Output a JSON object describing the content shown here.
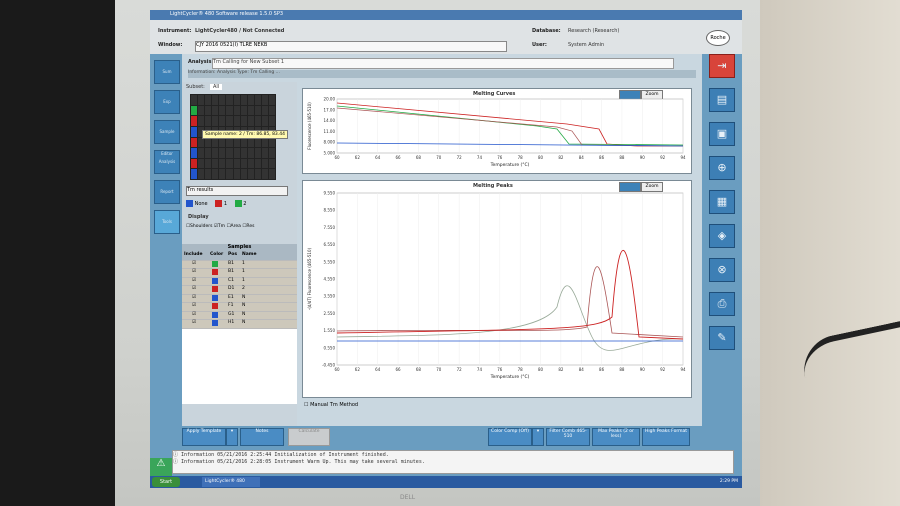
{
  "window": {
    "title": "LightCycler® 480 Software release 1.5.0 SP3"
  },
  "header": {
    "instrument_label": "Instrument:",
    "instrument_value": "LightCycler480 / Not Connected",
    "window_label": "Window:",
    "window_value": "CJY 2016 0521(I) TLRE NEKB",
    "database_label": "Database:",
    "database_value": "Research (Research)",
    "user_label": "User:",
    "user_value": "System Admin",
    "logo": "Roche"
  },
  "nav": {
    "items": [
      "Sum",
      "Exp",
      "Sample Editor",
      "Analysis",
      "Report",
      "Tools"
    ]
  },
  "analysis": {
    "label": "Analysis:",
    "value": "Tm Calling for New Subset 1",
    "info_label": "Information:",
    "info_value": "Analysis Type: Tm Calling ..."
  },
  "left": {
    "subset_label": "Subset:",
    "subset_value": "All",
    "tooltip": "Sample name: 2 / Tm: 86.85, 83.44",
    "results_select": "Tm results",
    "legend": [
      {
        "name": "None",
        "color": "#2255cc"
      },
      {
        "name": "1",
        "color": "#cc2222"
      },
      {
        "name": "2",
        "color": "#22aa44"
      }
    ],
    "display_label": "Display",
    "checks": [
      {
        "label": "Shoulders",
        "checked": false
      },
      {
        "label": "Tm",
        "checked": true
      },
      {
        "label": "Area",
        "checked": false
      },
      {
        "label": "Res",
        "checked": false
      }
    ],
    "samples_title": "Samples",
    "sample_cols": [
      "Include",
      "Color",
      "Pos",
      "Name"
    ],
    "samples": [
      {
        "pos": "B1",
        "name": "1",
        "color": "#22aa44"
      },
      {
        "pos": "B1",
        "name": "1",
        "color": "#cc2222"
      },
      {
        "pos": "C1",
        "name": "1",
        "color": "#2255cc"
      },
      {
        "pos": "D1",
        "name": "2",
        "color": "#cc2222"
      },
      {
        "pos": "E1",
        "name": "N",
        "color": "#2255cc"
      },
      {
        "pos": "F1",
        "name": "N",
        "color": "#cc2222"
      },
      {
        "pos": "G1",
        "name": "N",
        "color": "#2255cc"
      },
      {
        "pos": "H1",
        "name": "N",
        "color": "#2255cc"
      }
    ]
  },
  "curves": {
    "title": "Melting Curves",
    "xlabel": "Temperature (°C)",
    "ylabel": "Fluorescence (465-510)",
    "zoom": "Zoom",
    "yticks": [
      "20.00",
      "17.00",
      "14.00",
      "11.00",
      "8.000",
      "5.000"
    ],
    "xticks": [
      "60",
      "62",
      "64",
      "66",
      "68",
      "70",
      "72",
      "74",
      "76",
      "78",
      "80",
      "82",
      "84",
      "86",
      "88",
      "90",
      "92",
      "94"
    ]
  },
  "peaks": {
    "title": "Melting Peaks",
    "xlabel": "Temperature (°C)",
    "ylabel": "-(d/dT) Fluorescence (465-510)",
    "zoom": "Zoom",
    "yticks": [
      "9.550",
      "8.550",
      "7.550",
      "6.550",
      "5.550",
      "4.550",
      "3.550",
      "2.550",
      "1.550",
      "0.550",
      "-0.450"
    ],
    "xticks": [
      "60",
      "62",
      "64",
      "66",
      "68",
      "70",
      "72",
      "74",
      "76",
      "78",
      "80",
      "82",
      "84",
      "86",
      "88",
      "90",
      "92",
      "94"
    ],
    "manual_tm": "Manual Tm Method"
  },
  "bottom_buttons": {
    "apply": "Apply Template",
    "notes": "Notes",
    "calculate": "Calculate",
    "color_comp": "Color Comp (Off)",
    "filter_comb": "Filter Comb 465-510",
    "max_peaks": "Max Peaks (2 or less)",
    "high_peaks": "High Peaks Format"
  },
  "log": [
    {
      "type": "Information",
      "time": "05/21/2016 2:25:44",
      "msg": "Initialization of Instrument finished."
    },
    {
      "type": "Information",
      "time": "05/21/2016 2:28:05",
      "msg": "Instrument Warm Up. This may take several minutes."
    }
  ],
  "taskbar": {
    "start": "Start",
    "item": "LightCycler® 480",
    "clock": "2:29 PM"
  },
  "monitor_brand": "DELL"
}
